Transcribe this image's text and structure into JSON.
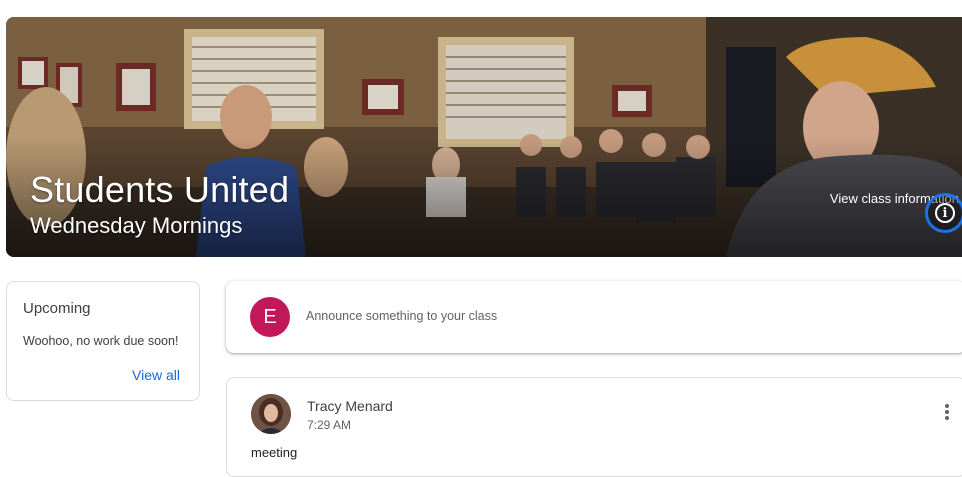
{
  "banner": {
    "title": "Students United",
    "section": "Wednesday Mornings",
    "info_label": "View class information",
    "info_icon": "info-icon"
  },
  "upcoming": {
    "title": "Upcoming",
    "message": "Woohoo, no work due soon!",
    "link": "View all"
  },
  "announce": {
    "avatar_letter": "E",
    "avatar_color": "#c2185b",
    "placeholder": "Announce something to your class"
  },
  "post": {
    "author": "Tracy Menard",
    "time": "7:29 AM",
    "body": "meeting",
    "menu_icon": "more-vert-icon"
  },
  "colors": {
    "accent": "#1967d2",
    "info_ring": "#1a73e8"
  }
}
